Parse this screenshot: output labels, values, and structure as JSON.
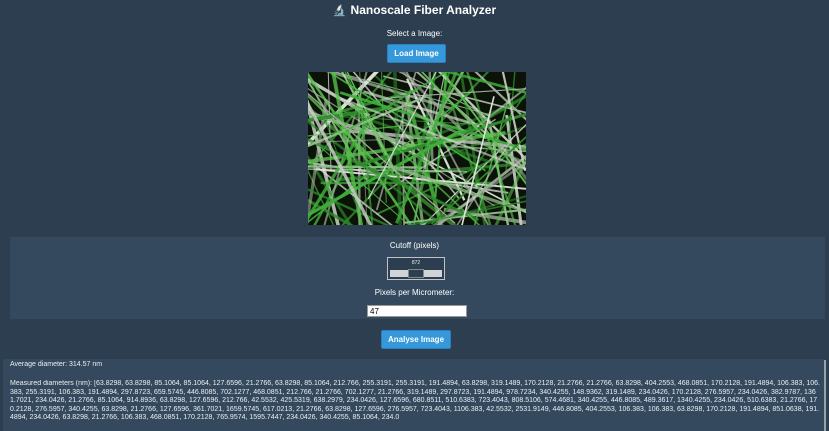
{
  "header": {
    "title": "Nanoscale Fiber Analyzer",
    "icon": "microscope-icon"
  },
  "image_section": {
    "select_label": "Select a Image:",
    "load_button": "Load Image"
  },
  "controls": {
    "cutoff_label": "Cutoff (pixels)",
    "cutoff_value": "872",
    "cutoff_fraction": 0.5,
    "ppm_label": "Pixels per Micrometer:",
    "ppm_value": "47",
    "analyse_button": "Analyse Image"
  },
  "results": {
    "average": "Average diameter: 314.57 nm",
    "diameters": "Measured diameters (nm): [63.8298, 63.8298, 85.1064, 85.1064, 127.6596, 21.2766, 63.8298, 85.1064, 212.766, 255.3191, 255.3191, 191.4894, 63.8298, 319.1489, 170.2128, 21.2766, 21.2766, 63.8298, 404.2553, 468.0851, 170.2128, 191.4894, 106.383, 106.383, 255.3191, 106.383, 191.4894, 297.8723, 659.5745, 446.8085, 702.1277, 468.0851, 212.766, 21.2766, 702.1277, 21.2766, 319.1489, 297.8723, 191.4894, 978.7234, 340.4255, 148.9362, 319.1489, 234.0426, 170.2128, 276.5957, 234.0426, 382.9787, 1361.7021, 234.0426, 21.2766, 85.1064, 914.8936, 63.8298, 127.6596, 212.766, 42.5532, 425.5319, 638.2979, 234.0426, 127.6596, 680.8511, 510.6383, 723.4043, 808.5106, 574.4681, 340.4255, 446.8085, 489.3617, 1340.4255, 234.0426, 510.6383, 21.2766, 170.2128, 276.5957, 340.4255, 63.8298, 21.2766, 127.6596, 361.7021, 1659.5745, 617.0213, 21.2766, 63.8298, 127.6596, 276.5957, 723.4043, 1106.383, 42.5532, 2531.9149, 446.8085, 404.2553, 106.383, 106.383, 63.8298, 170.2128, 191.4894, 851.0638, 191.4894, 234.0426, 63.8298, 21.2766, 106.383, 468.0851, 170.2128, 765.9574, 1595.7447, 234.0426, 340.4255, 85.1064, 234.0"
  },
  "colors": {
    "background": "#2c3e50",
    "panel": "#34495e",
    "button": "#3498db",
    "fiber": "#3fae3a"
  }
}
